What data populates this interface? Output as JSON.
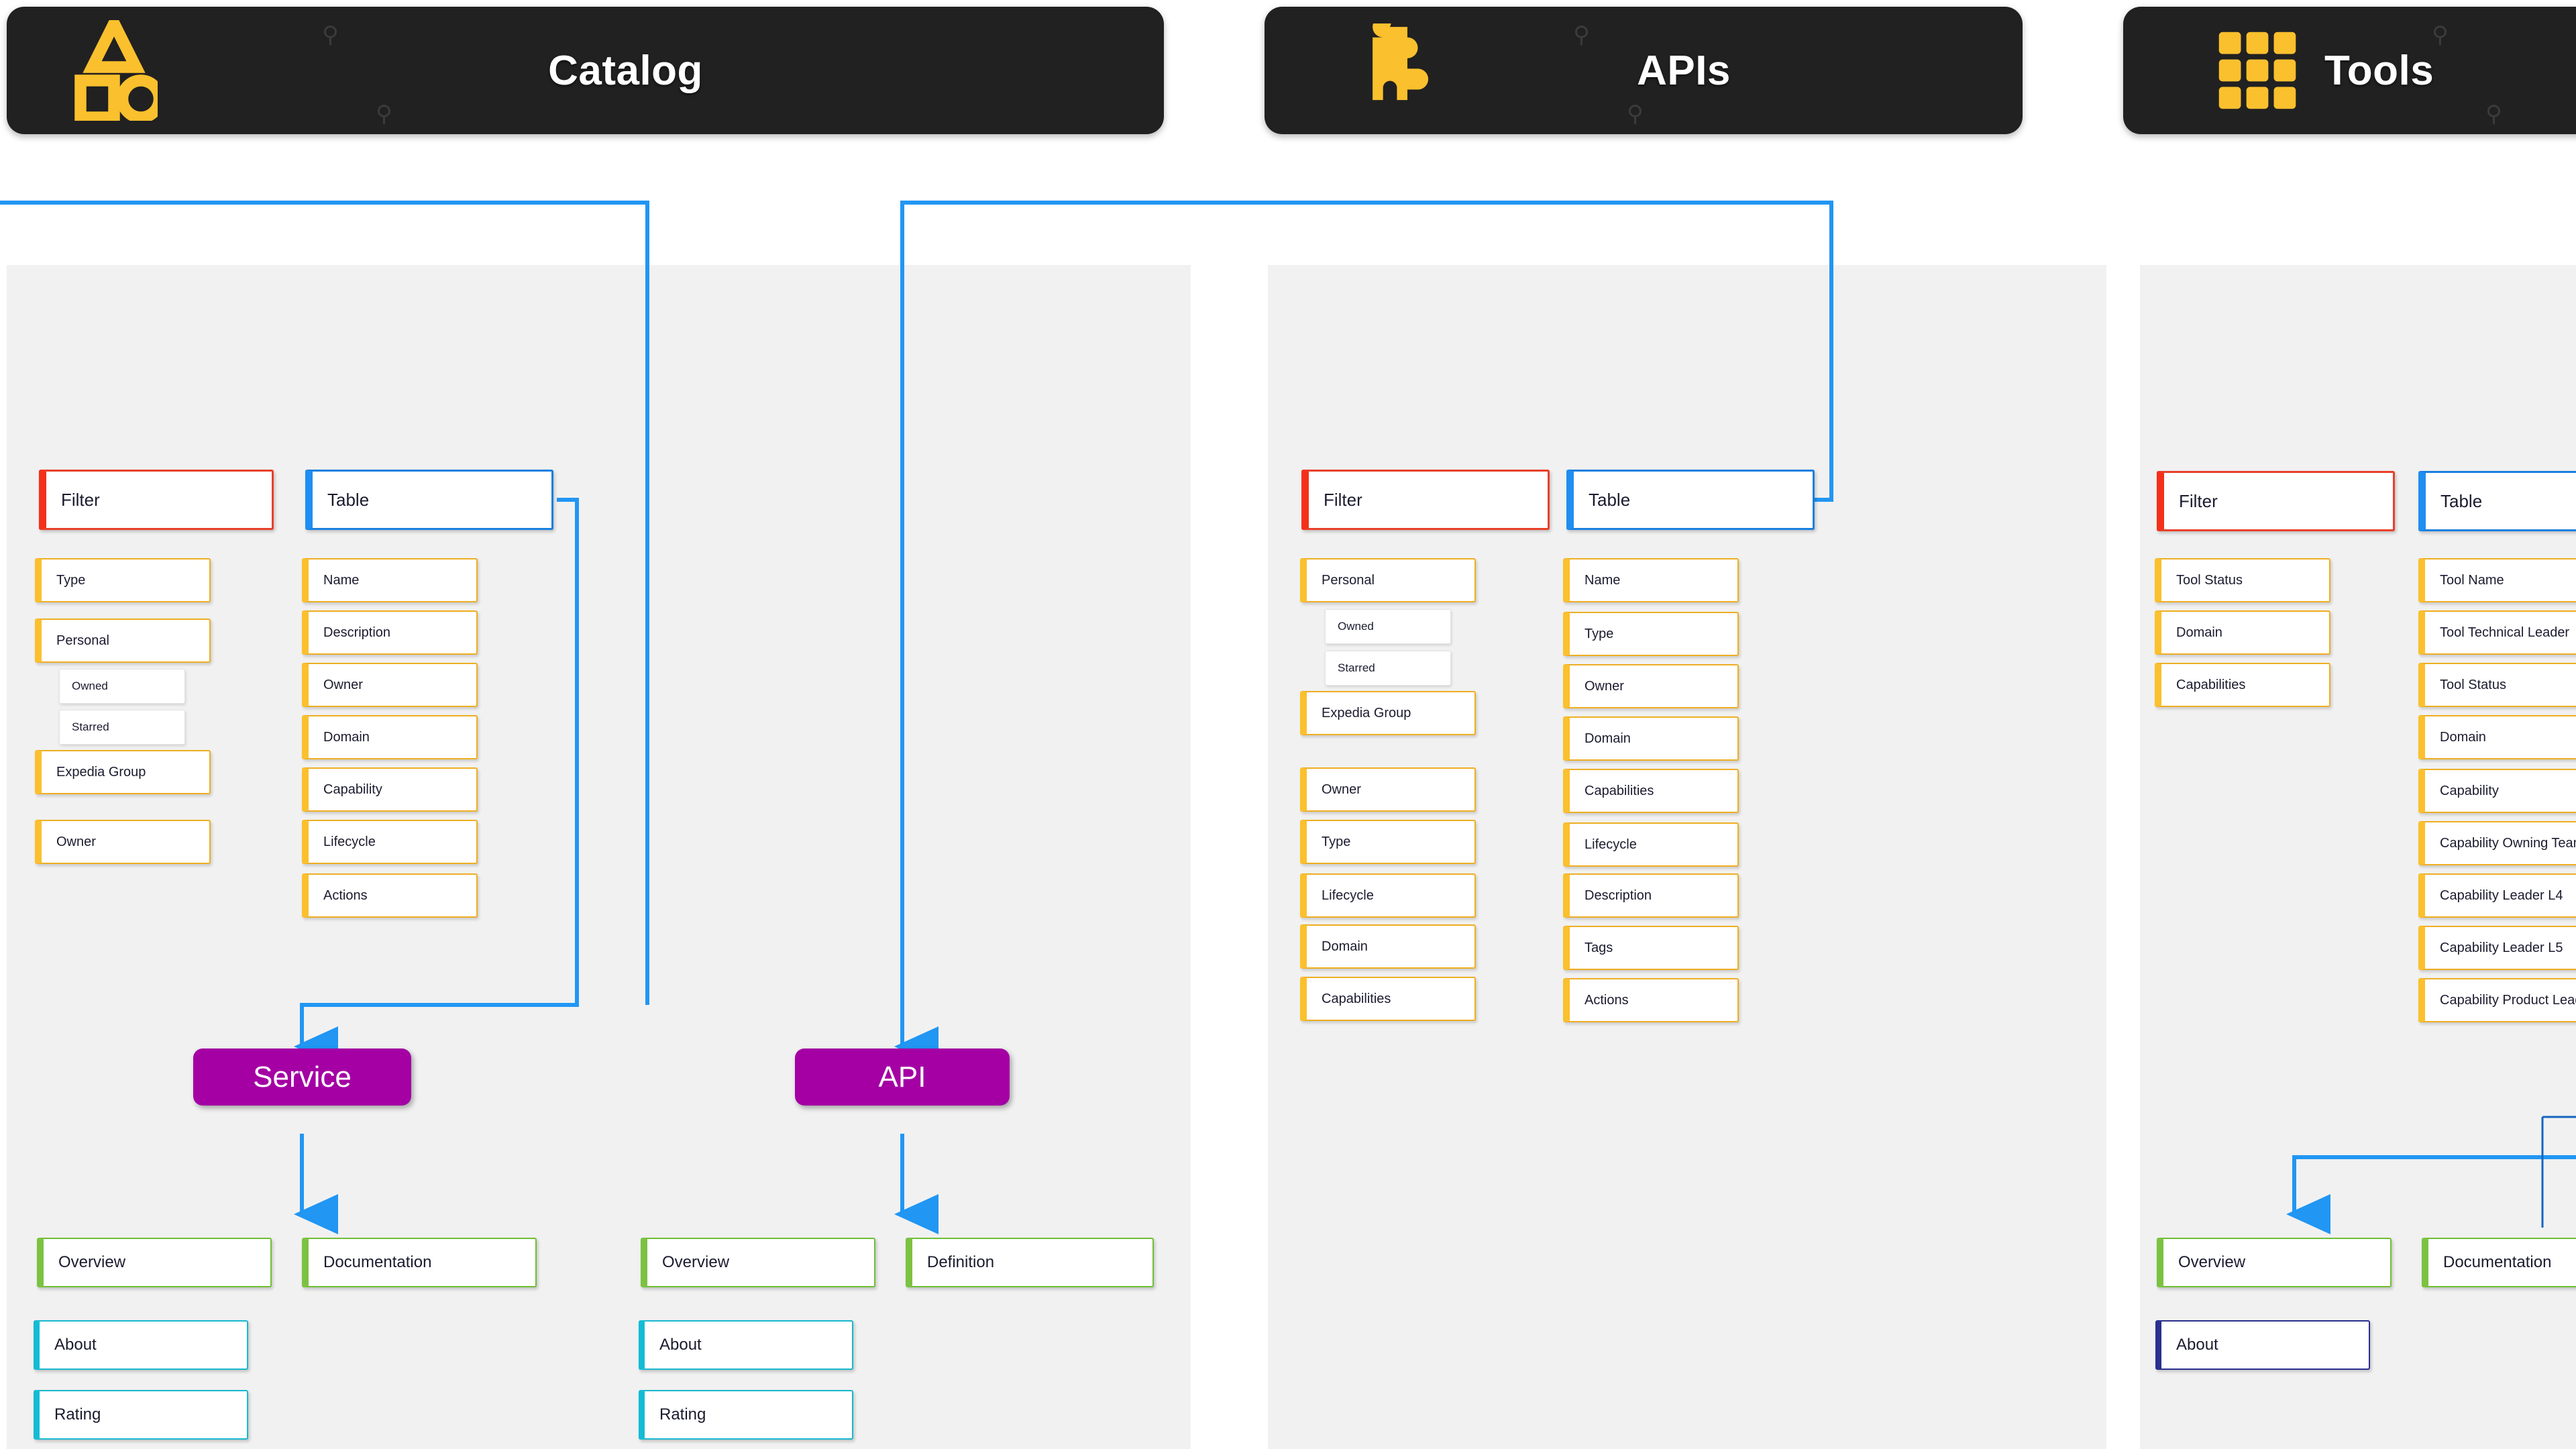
{
  "headers": [
    {
      "title": "Catalog",
      "icon": "shapes-icon"
    },
    {
      "title": "APIs",
      "icon": "puzzle-piece-icon"
    },
    {
      "title": "Tools",
      "icon": "grid-3x3-icon"
    }
  ],
  "columns": [
    {
      "key": "catalog",
      "filter": {
        "label": "Filter",
        "items": [
          {
            "label": "Type"
          },
          {
            "label": "Personal",
            "children": [
              {
                "label": "Owned"
              },
              {
                "label": "Starred"
              }
            ]
          },
          {
            "label": "Expedia Group"
          },
          {
            "label": "Owner"
          }
        ]
      },
      "table": {
        "label": "Table",
        "items": [
          {
            "label": "Name"
          },
          {
            "label": "Description"
          },
          {
            "label": "Owner"
          },
          {
            "label": "Domain"
          },
          {
            "label": "Capability"
          },
          {
            "label": "Lifecycle"
          },
          {
            "label": "Actions"
          }
        ]
      },
      "entity": "Service",
      "tabs": [
        {
          "label": "Overview"
        },
        {
          "label": "Documentation"
        }
      ],
      "sections": [
        {
          "label": "About"
        },
        {
          "label": "Rating"
        }
      ]
    },
    {
      "key": "apis",
      "filter": {
        "label": "Filter",
        "items": [
          {
            "label": "Personal",
            "children": [
              {
                "label": "Owned"
              },
              {
                "label": "Starred"
              }
            ]
          },
          {
            "label": "Expedia Group"
          },
          {
            "label": "Owner"
          },
          {
            "label": "Type"
          },
          {
            "label": "Lifecycle"
          },
          {
            "label": "Domain"
          },
          {
            "label": "Capabilities"
          }
        ]
      },
      "table": {
        "label": "Table",
        "items": [
          {
            "label": "Name"
          },
          {
            "label": "Type"
          },
          {
            "label": "Owner"
          },
          {
            "label": "Domain"
          },
          {
            "label": "Capabilities"
          },
          {
            "label": "Lifecycle"
          },
          {
            "label": "Description"
          },
          {
            "label": "Tags"
          },
          {
            "label": "Actions"
          }
        ]
      },
      "entity": "API",
      "tabs": [
        {
          "label": "Overview"
        },
        {
          "label": "Definition"
        }
      ],
      "sections": [
        {
          "label": "About"
        },
        {
          "label": "Rating"
        }
      ]
    },
    {
      "key": "tools",
      "filter": {
        "label": "Filter",
        "items": [
          {
            "label": "Tool Status"
          },
          {
            "label": "Domain"
          },
          {
            "label": "Capabilities"
          }
        ]
      },
      "table": {
        "label": "Table",
        "items": [
          {
            "label": "Tool Name"
          },
          {
            "label": "Tool Technical Leader"
          },
          {
            "label": "Tool Status"
          },
          {
            "label": "Domain"
          },
          {
            "label": "Capability"
          },
          {
            "label": "Capability Owning Team"
          },
          {
            "label": "Capability Leader L4"
          },
          {
            "label": "Capability Leader L5"
          },
          {
            "label": "Capability Product Leader"
          }
        ]
      },
      "entity": "",
      "tabs": [
        {
          "label": "Overview"
        },
        {
          "label": "Documentation"
        }
      ],
      "sections": [
        {
          "label": "About"
        }
      ]
    }
  ],
  "colors": {
    "header_bg": "#212121",
    "accent_yellow": "#fbc02d",
    "filter_red": "#f4301a",
    "table_blue": "#1f8ef1",
    "entity_purple": "#a400a4",
    "tab_green": "#7cc242",
    "section_cyan": "#12bcd4",
    "section_navy": "#2b2f8f",
    "panel_bg": "#f1f1f1",
    "wire_blue": "#2196f3"
  }
}
